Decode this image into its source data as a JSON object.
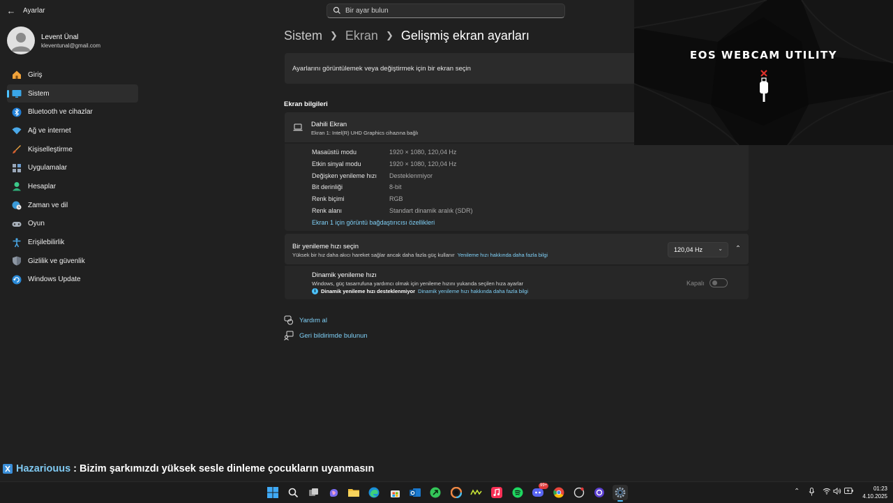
{
  "window": {
    "title": "Ayarlar"
  },
  "search": {
    "placeholder": "Bir ayar bulun"
  },
  "user": {
    "name": "Levent Ünal",
    "email": "kleventunal@gmail.com"
  },
  "sidebar": {
    "items": [
      {
        "label": "Giriş",
        "icon": "home-icon"
      },
      {
        "label": "Sistem",
        "icon": "system-icon",
        "active": true
      },
      {
        "label": "Bluetooth ve cihazlar",
        "icon": "bluetooth-icon"
      },
      {
        "label": "Ağ ve internet",
        "icon": "network-icon"
      },
      {
        "label": "Kişiselleştirme",
        "icon": "brush-icon"
      },
      {
        "label": "Uygulamalar",
        "icon": "apps-icon"
      },
      {
        "label": "Hesaplar",
        "icon": "account-icon"
      },
      {
        "label": "Zaman ve dil",
        "icon": "globe-clock-icon"
      },
      {
        "label": "Oyun",
        "icon": "gamepad-icon"
      },
      {
        "label": "Erişilebilirlik",
        "icon": "accessibility-icon"
      },
      {
        "label": "Gizlilik ve güvenlik",
        "icon": "shield-icon"
      },
      {
        "label": "Windows Update",
        "icon": "update-icon"
      }
    ]
  },
  "breadcrumb": {
    "level1": "Sistem",
    "level2": "Ekran",
    "current": "Gelişmiş ekran ayarları"
  },
  "select_display": {
    "text": "Ayarlarını görüntülemek veya değiştirmek için bir ekran seçin"
  },
  "display_info": {
    "section_title": "Ekran bilgileri",
    "name": "Dahili Ekran",
    "subtitle": "Ekran 1: Intel(R) UHD Graphics cihazına bağlı",
    "rows": [
      {
        "label": "Masaüstü modu",
        "value": "1920 × 1080, 120,04 Hz"
      },
      {
        "label": "Etkin sinyal modu",
        "value": "1920 × 1080, 120,04 Hz"
      },
      {
        "label": "Değişken yenileme hızı",
        "value": "Desteklenmiyor"
      },
      {
        "label": "Bit derinliği",
        "value": "8-bit"
      },
      {
        "label": "Renk biçimi",
        "value": "RGB"
      },
      {
        "label": "Renk alanı",
        "value": "Standart dinamik aralık (SDR)"
      }
    ],
    "adapter_link": "Ekran 1 için görüntü bağdaştırıcısı özellikleri"
  },
  "refresh_rate": {
    "title": "Bir yenileme hızı seçin",
    "subtitle": "Yüksek bir hız daha akıcı hareket sağlar ancak daha fazla güç kullanır",
    "learn_link": "Yenileme hızı hakkında daha fazla bilgi",
    "selected": "120,04 Hz"
  },
  "dynamic_refresh": {
    "title": "Dinamik yenileme hızı",
    "subtitle": "Windows, güç tasarrufuna yardımcı olmak için yenileme hızını yukarıda seçilen hıza ayarlar",
    "note": "Dinamik yenileme hızı desteklenmiyor",
    "note_link": "Dinamik yenileme hızı hakkında daha fazla bilgi",
    "toggle_label": "Kapalı",
    "toggle_on": false
  },
  "footer_links": {
    "help": "Yardım al",
    "feedback": "Geri bildirimde bulunun"
  },
  "webcam_overlay": {
    "title": "EOS WEBCAM UTILITY"
  },
  "caption": {
    "artist": "Hazariouus",
    "separator": ":",
    "text": "Bizim şarkımızdı yüksek sesle dinleme çocukların uyanmasın"
  },
  "taskbar": {
    "apps": [
      "start-icon",
      "search-icon",
      "task-view-icon",
      "copilot-icon",
      "file-explorer-icon",
      "edge-icon",
      "store-icon",
      "outlook-icon",
      "app-icon",
      "color-icon",
      "app-icon",
      "music-icon",
      "spotify-icon",
      "discord-icon",
      "chrome-icon",
      "app-icon",
      "app-icon",
      "settings-icon"
    ],
    "discord_badge": "99+",
    "clock": {
      "time": "01:23",
      "date": "4.10.2025"
    }
  },
  "colors": {
    "accent": "#4cc2ff",
    "link": "#7fd0f7",
    "background": "#202020",
    "card": "#2b2b2b"
  }
}
